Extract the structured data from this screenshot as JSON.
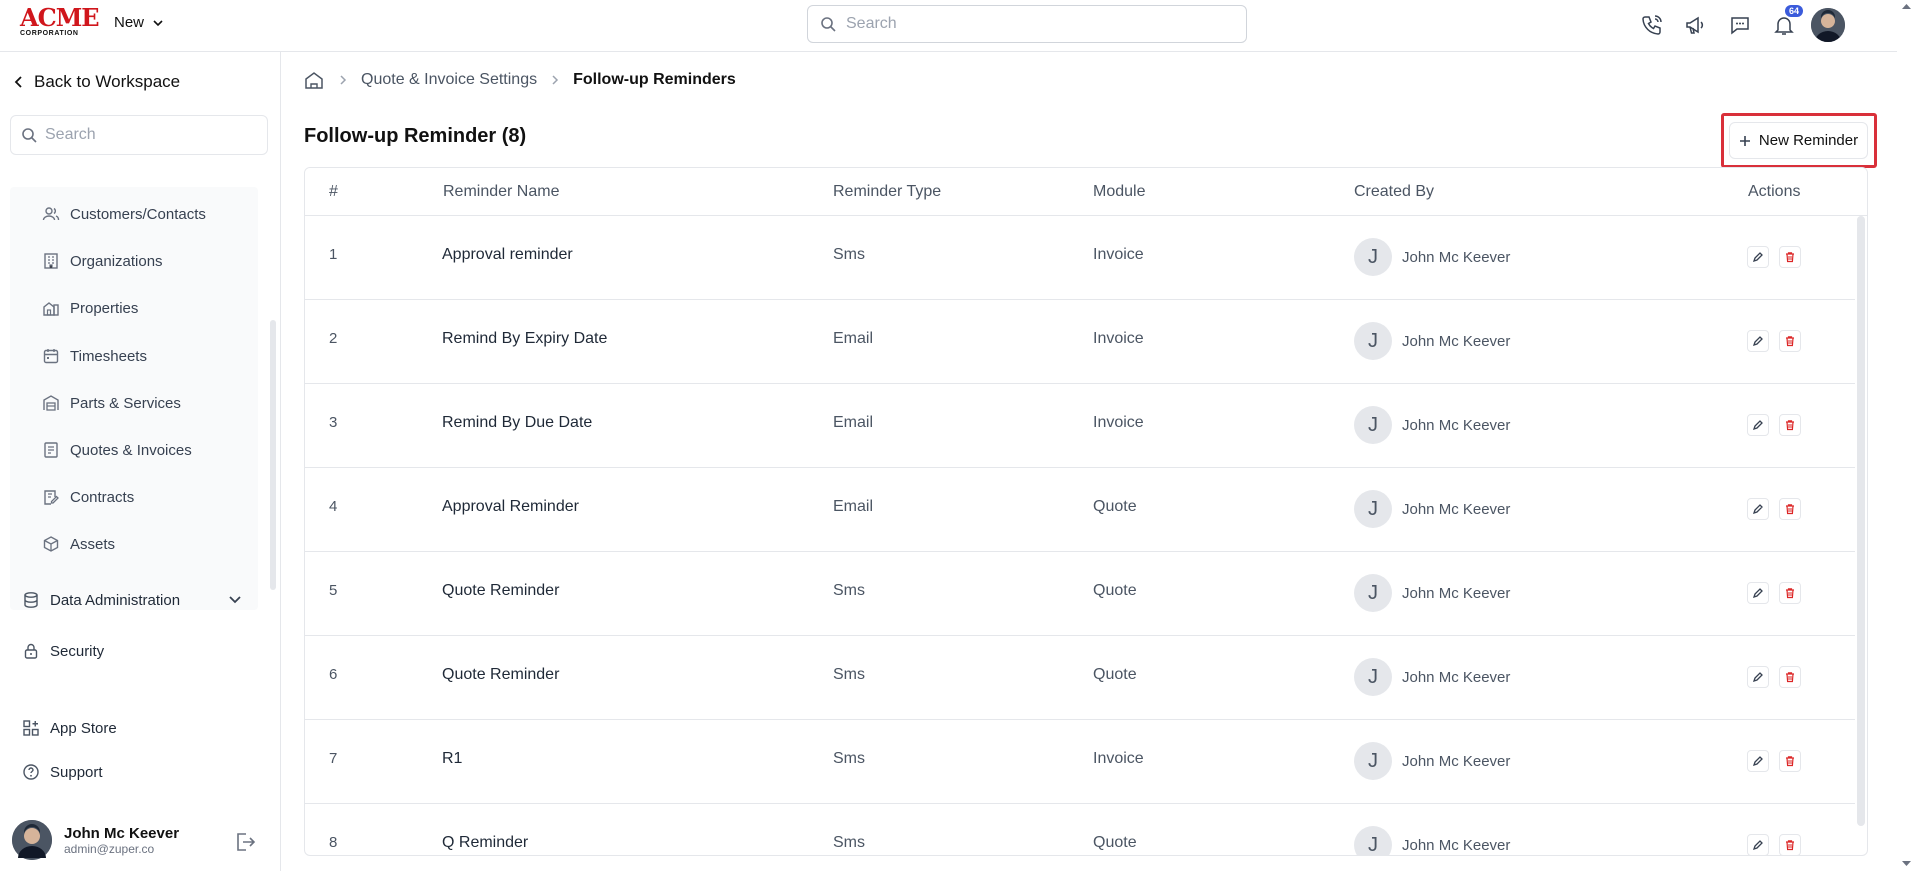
{
  "topbar": {
    "logo_main": "ACME",
    "logo_sub": "CORPORATION",
    "new_label": "New",
    "search_placeholder": "Search",
    "notification_count": "64"
  },
  "sidebar": {
    "back_label": "Back to Workspace",
    "search_placeholder": "Search",
    "group_items": [
      {
        "label": "Customers/Contacts",
        "icon": "users-icon"
      },
      {
        "label": "Organizations",
        "icon": "building-icon"
      },
      {
        "label": "Properties",
        "icon": "property-icon"
      },
      {
        "label": "Timesheets",
        "icon": "calendar-icon"
      },
      {
        "label": "Parts & Services",
        "icon": "warehouse-icon"
      },
      {
        "label": "Quotes & Invoices",
        "icon": "invoice-icon"
      },
      {
        "label": "Contracts",
        "icon": "contract-icon"
      },
      {
        "label": "Assets",
        "icon": "cube-icon"
      }
    ],
    "data_admin": "Data Administration",
    "security": "Security",
    "app_store": "App Store",
    "support": "Support",
    "user_name": "John Mc Keever",
    "user_email": "admin@zuper.co"
  },
  "main": {
    "breadcrumb_1": "Quote & Invoice Settings",
    "breadcrumb_2": "Follow-up Reminders",
    "title": "Follow-up Reminder (8)",
    "new_reminder": "New Reminder",
    "columns": [
      "#",
      "Reminder Name",
      "Reminder Type",
      "Module",
      "Created By",
      "Actions"
    ],
    "rows": [
      {
        "num": "1",
        "name": "Approval reminder",
        "type": "Sms",
        "module": "Invoice",
        "initial": "J",
        "created_by": "John Mc Keever"
      },
      {
        "num": "2",
        "name": "Remind By Expiry Date",
        "type": "Email",
        "module": "Invoice",
        "initial": "J",
        "created_by": "John Mc Keever"
      },
      {
        "num": "3",
        "name": "Remind By Due Date",
        "type": "Email",
        "module": "Invoice",
        "initial": "J",
        "created_by": "John Mc Keever"
      },
      {
        "num": "4",
        "name": "Approval Reminder",
        "type": "Email",
        "module": "Quote",
        "initial": "J",
        "created_by": "John Mc Keever"
      },
      {
        "num": "5",
        "name": "Quote Reminder",
        "type": "Sms",
        "module": "Quote",
        "initial": "J",
        "created_by": "John Mc Keever"
      },
      {
        "num": "6",
        "name": "Quote Reminder",
        "type": "Sms",
        "module": "Quote",
        "initial": "J",
        "created_by": "John Mc Keever"
      },
      {
        "num": "7",
        "name": "R1",
        "type": "Sms",
        "module": "Invoice",
        "initial": "J",
        "created_by": "John Mc Keever"
      },
      {
        "num": "8",
        "name": "Q Reminder",
        "type": "Sms",
        "module": "Quote",
        "initial": "J",
        "created_by": "John Mc Keever"
      }
    ]
  },
  "colors": {
    "brand_red": "#d0161c",
    "highlight": "#d9303a",
    "badge": "#3b5bdb",
    "delete": "#dc2626"
  }
}
